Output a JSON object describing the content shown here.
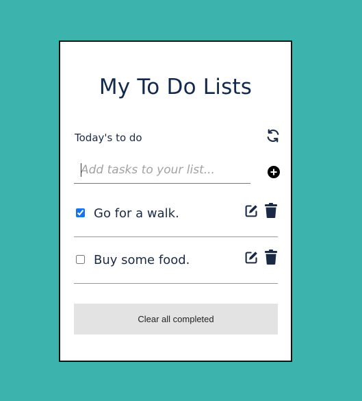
{
  "app": {
    "title": "My To Do Lists",
    "subheading": "Today's to do"
  },
  "input": {
    "placeholder": "Add tasks to your list...",
    "value": ""
  },
  "tasks": [
    {
      "text": "Go for a walk.",
      "checked": true
    },
    {
      "text": "Buy some food.",
      "checked": false
    }
  ],
  "actions": {
    "clear_label": "Clear all completed"
  },
  "icons": {
    "refresh": "refresh-icon",
    "add": "plus-circle-icon",
    "edit": "edit-icon",
    "delete": "trash-icon"
  },
  "colors": {
    "background": "#3db3ad",
    "card": "#ffffff",
    "text": "#13294b",
    "icon": "#1b2a44",
    "button": "#e3e3e3"
  }
}
